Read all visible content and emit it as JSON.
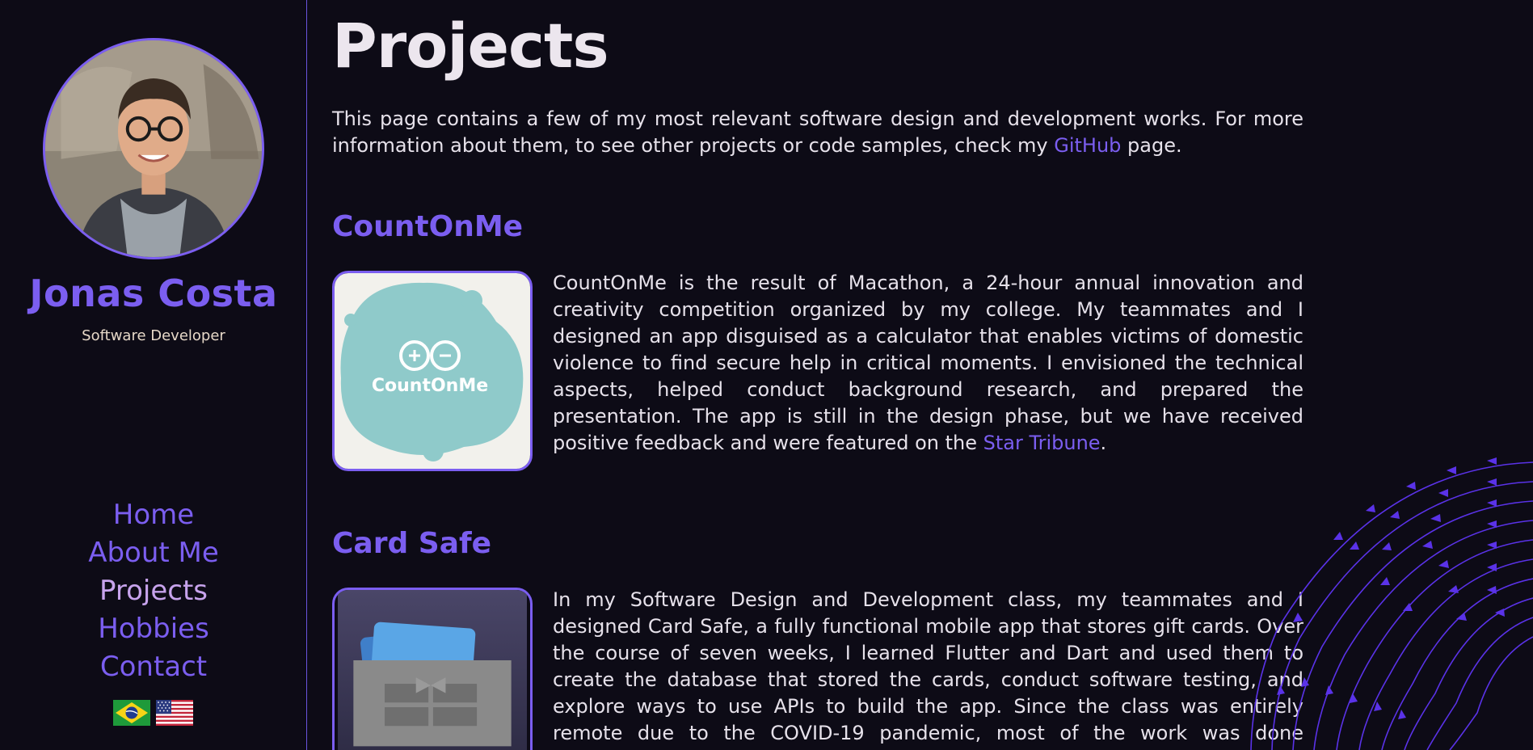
{
  "sidebar": {
    "name": "Jonas Costa",
    "role": "Software Developer",
    "nav": [
      "Home",
      "About Me",
      "Projects",
      "Hobbies",
      "Contact"
    ]
  },
  "page": {
    "title": "Projects",
    "intro_before_link": "This page contains a few of my most relevant software design and development works. For more information about them, to see other projects or code samples, check my ",
    "intro_link": "GitHub",
    "intro_after_link": " page."
  },
  "projects": [
    {
      "title": "CountOnMe",
      "thumb_text": "CountOnMe",
      "text_before_link": "CountOnMe is the result of Macathon, a 24-hour annual innovation and creativity competition organized by my college. My teammates and I designed an app disguised as a calculator that enables victims of domestic violence to find secure help in critical moments. I envisioned the technical aspects, helped conduct background research, and prepared the presentation. The app is still in the design phase, but we have received positive feedback and were featured on the ",
      "link": "Star Tribune",
      "text_after_link": "."
    },
    {
      "title": "Card Safe",
      "text": "In my Software Design and Development class, my teammates and I designed Card Safe, a fully functional mobile app that stores gift cards. Over the course of seven weeks, I learned Flutter and Dart and used them to create the database that stored the cards, conduct software testing, and explore ways to use APIs to build the app. Since the class was entirely remote due to the COVID-19 pandemic, most of the work was done asynchronously."
    }
  ],
  "colors": {
    "background": "#0d0b16",
    "accent": "#7b5ef0",
    "active_nav": "#c7a3ec",
    "text": "#e6e1ea"
  },
  "icons": [
    "brazil-flag-icon",
    "us-flag-icon",
    "plus-minus-icon",
    "gift-box-icon"
  ]
}
